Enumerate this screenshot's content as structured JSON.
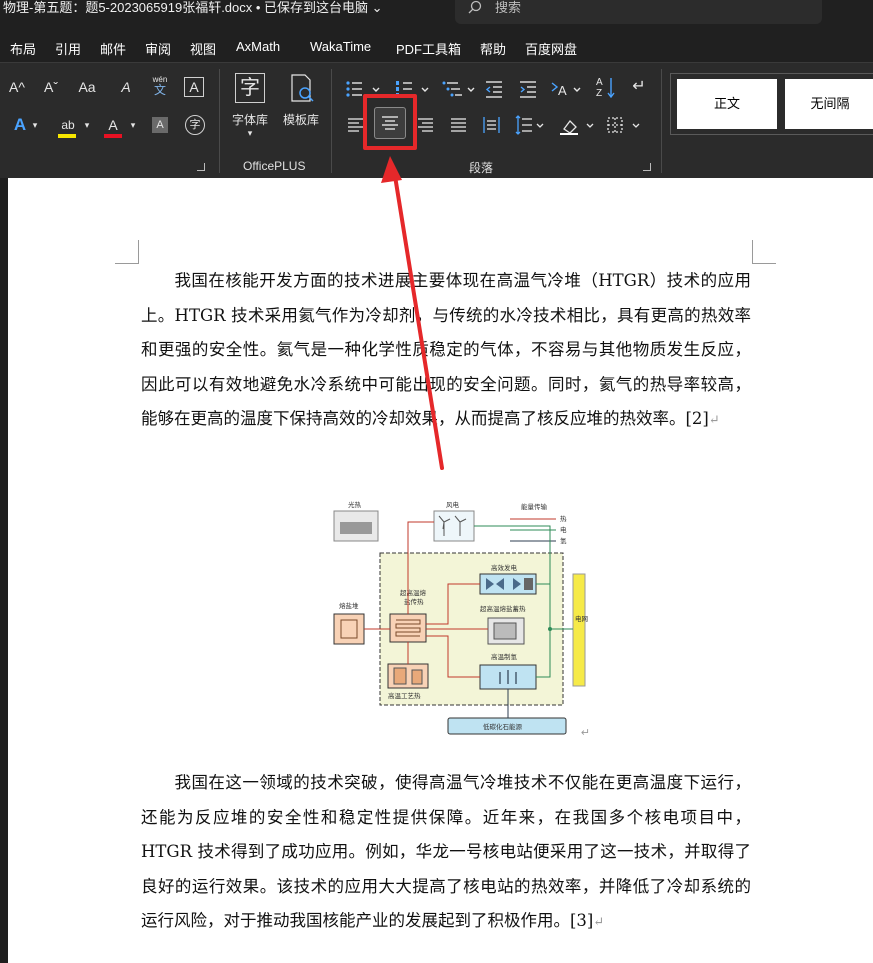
{
  "titlebar": {
    "doc_title": "物理-第五题：题5-2023065919张福轩.docx • 已保存到这台电脑 ⌄",
    "search_placeholder": "搜索"
  },
  "menu": {
    "tabs": [
      "布局",
      "引用",
      "邮件",
      "审阅",
      "视图",
      "AxMath",
      "WakaTime",
      "PDF工具箱",
      "帮助",
      "百度网盘"
    ]
  },
  "ribbon": {
    "font_group": {
      "grow_font": "A^",
      "shrink_font": "Aˇ",
      "change_case": "Aa",
      "clear_format": "A",
      "phonetic_top": "wén",
      "phonetic_bottom": "文",
      "char_border": "A",
      "text_effects": "A",
      "highlight": "ab",
      "font_color": "A",
      "char_shading": "A",
      "enclose_char": "字"
    },
    "officeplus": {
      "font_lib_icon": "字",
      "font_lib": "字体库",
      "template_lib": "模板库",
      "group_label": "OfficePLUS"
    },
    "paragraph": {
      "group_label": "段落",
      "sort_top": "A",
      "sort_bottom": "Z"
    },
    "styles": {
      "normal": "正文",
      "no_spacing": "无间隔"
    }
  },
  "document": {
    "para1": "我国在核能开发方面的技术进展主要体现在高温气冷堆（HTGR）技术的应用上。HTGR 技术采用氦气作为冷却剂，与传统的水冷技术相比，具有更高的热效率和更强的安全性。氦气是一种化学性质稳定的气体，不容易与其他物质发生反应，因此可以有效地避免水冷系统中可能出现的安全问题。同时，氦气的热导率较高，能够在更高的温度下保持高效的冷却效果，从而提高了核反应堆的热效率。[2]",
    "para2": "我国在这一领域的技术突破，使得高温气冷堆技术不仅能在更高温度下运行，还能为反应堆的安全性和稳定性提供保障。近年来，在我国多个核电项目中，HTGR 技术得到了成功应用。例如，华龙一号核电站便采用了这一技术，并取得了良好的运行效果。该技术的应用大大提高了核电站的热效率，并降低了冷却系统的运行风险，对于推动我国核能产业的发展起到了积极作用。[3]",
    "para_mark": "↵",
    "figure": {
      "solar": "光热",
      "wind": "风电",
      "legend_title": "能量传输",
      "legend_heat": "热",
      "legend_elec": "电",
      "legend_h2": "氢",
      "efficient_power": "高效发电",
      "salt_heat_line1": "超高温熔",
      "salt_heat_line2": "盐传热",
      "molten_salt_reactor": "熔盐堆",
      "salt_storage": "超高温熔盐蓄热",
      "grid": "电网",
      "h2_production": "高温制氢",
      "process_heat": "高温工艺热",
      "low_carbon": "低碳化石能源"
    }
  },
  "colors": {
    "highlight_red": "#e5282a",
    "highlight_yellow": "#f7e600",
    "font_red": "#e81123"
  }
}
